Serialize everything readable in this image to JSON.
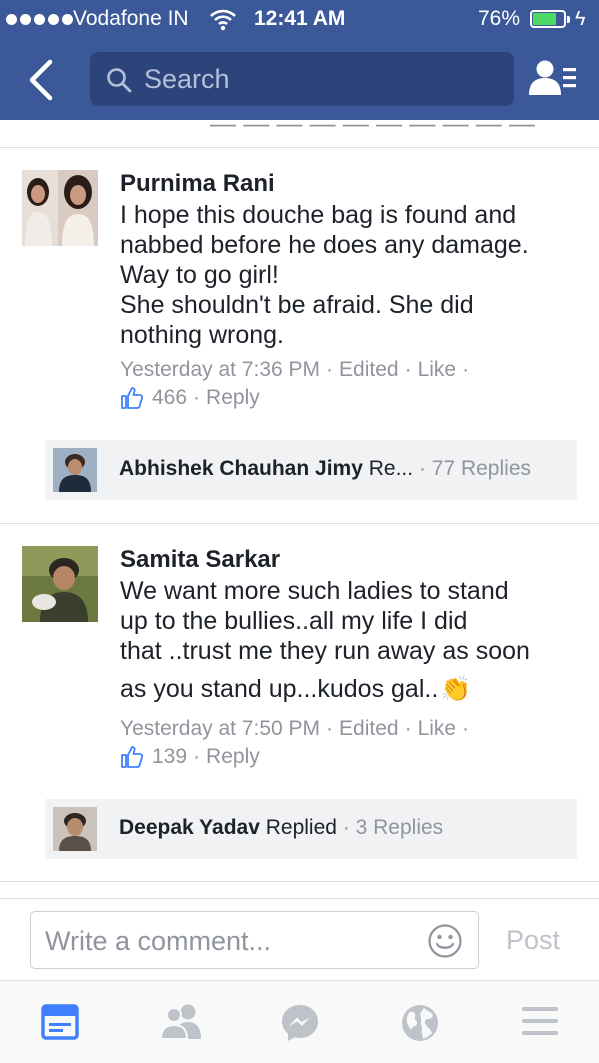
{
  "status_bar": {
    "carrier": "Vodafone IN",
    "time": "12:41 AM",
    "battery_percent": "76%",
    "battery_level": 0.76,
    "icons": [
      "signal-dots-icon",
      "wifi-icon",
      "battery-icon",
      "charging-icon"
    ]
  },
  "nav": {
    "back_icon": "chevron-left-icon",
    "search_placeholder": "Search",
    "friends_icon": "friend-requests-icon"
  },
  "comments": [
    {
      "author": "Purnima Rani",
      "lines": [
        "I hope this douche bag is found and",
        "nabbed before he does any damage.",
        "Way to go girl!",
        "She shouldn't be afraid. She did",
        "nothing wrong."
      ],
      "timestamp": "Yesterday at 7:36 PM",
      "edited": "Edited",
      "like_label": "Like",
      "like_count": "466",
      "reply_label": "Reply",
      "reply_preview": {
        "name": "Abhishek Chauhan Jimy",
        "action": "Re...",
        "replies": "77 Replies"
      }
    },
    {
      "author": "Samita Sarkar",
      "lines": [
        "We want more such ladies to stand",
        "up to the bullies..all my life I did",
        "that ..trust me they run away as soon",
        "as you stand up...kudos gal.."
      ],
      "emoji": "👏",
      "timestamp": "Yesterday at 7:50 PM",
      "edited": "Edited",
      "like_label": "Like",
      "like_count": "139",
      "reply_label": "Reply",
      "reply_preview": {
        "name": "Deepak Yadav",
        "action": "Replied",
        "replies": "3 Replies"
      }
    }
  ],
  "composer": {
    "placeholder": "Write a comment...",
    "post_label": "Post",
    "emoji_icon": "smiley-icon"
  },
  "tabbar": {
    "tabs": [
      "news-feed-icon",
      "friends-icon",
      "messenger-icon",
      "globe-notifications-icon",
      "menu-icon"
    ],
    "active_tab": "news-feed-icon",
    "active_color": "#4080ff",
    "inactive_color": "#bec3c9"
  },
  "colors": {
    "header_blue": "#3b5998",
    "search_field": "#2c4479",
    "meta_gray": "#90949c"
  }
}
